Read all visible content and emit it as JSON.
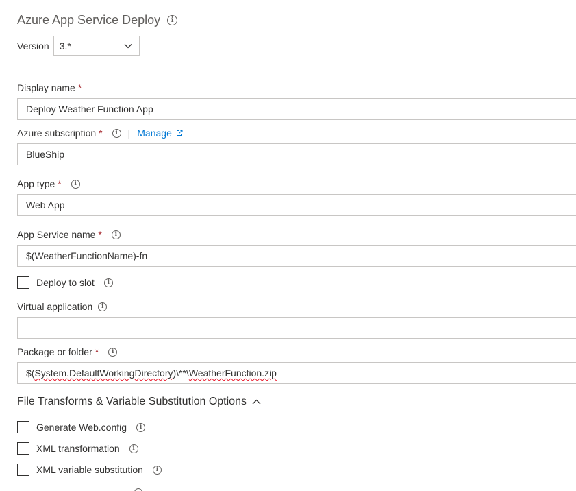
{
  "header": {
    "title": "Azure App Service Deploy",
    "info_icon": "info-icon"
  },
  "version": {
    "label": "Version",
    "selected": "3.*",
    "icon": "chevron-down-icon"
  },
  "fields": {
    "display_name": {
      "label": "Display name",
      "required": "*",
      "value": "Deploy Weather Function App"
    },
    "azure_subscription": {
      "label": "Azure subscription",
      "required": "*",
      "separator": "|",
      "manage_link": "Manage",
      "value": "BlueShip"
    },
    "app_type": {
      "label": "App type",
      "required": "*",
      "value": "Web App"
    },
    "app_service_name": {
      "label": "App Service name",
      "required": "*",
      "value": "$(WeatherFunctionName)-fn"
    },
    "deploy_to_slot": {
      "label": "Deploy to slot",
      "checked": false
    },
    "virtual_application": {
      "label": "Virtual application",
      "value": ""
    },
    "package_or_folder": {
      "label": "Package or folder",
      "required": "*",
      "value_prefix": "$(",
      "value_var": "System.DefaultWorkingDirectory",
      "value_mid": ")\\**\\",
      "value_file": "WeatherFunction.zip"
    }
  },
  "section": {
    "title": "File Transforms & Variable Substitution Options",
    "icon": "chevron-up-icon",
    "options": [
      {
        "label": "Generate Web.config",
        "checked": false
      },
      {
        "label": "XML transformation",
        "checked": false
      },
      {
        "label": "XML variable substitution",
        "checked": false
      }
    ]
  },
  "colors": {
    "required": "#a4262c",
    "link": "#0078d4",
    "border": "#c8c6c4",
    "spellcheck": "#e81123"
  }
}
